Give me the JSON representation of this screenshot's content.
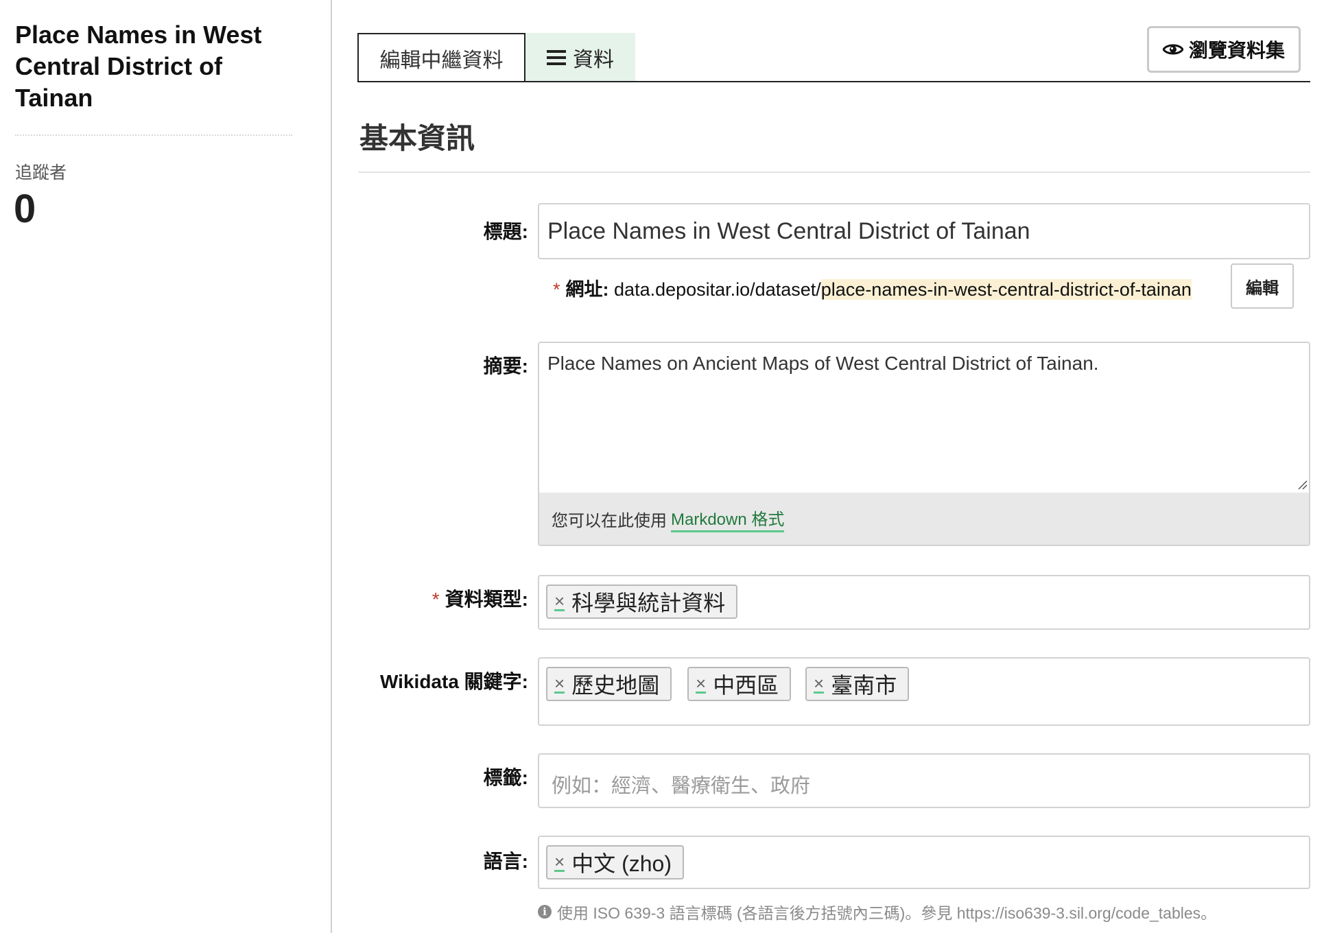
{
  "sidebar": {
    "dataset_title": "Place Names in West Central District of Tainan",
    "followers_label": "追蹤者",
    "followers_count": "0"
  },
  "tabs": [
    {
      "label": "編輯中繼資料"
    },
    {
      "label": "資料",
      "icon": "menu-icon"
    }
  ],
  "view_button": {
    "label": "瀏覽資料集",
    "icon": "eye-icon"
  },
  "section_title": "基本資訊",
  "form": {
    "title": {
      "label": "標題:",
      "value": "Place Names in West Central District of Tainan"
    },
    "url": {
      "required_mark": "*",
      "label": "網址:",
      "prefix": "data.depositar.io/dataset/",
      "slug": "place-names-in-west-central-district-of-tainan",
      "edit_label": "編輯"
    },
    "abstract": {
      "label": "摘要:",
      "value": "Place Names on Ancient Maps of West Central District of Tainan.",
      "markdown_prefix": "您可以在此使用",
      "markdown_link": "Markdown 格式"
    },
    "data_type": {
      "required_mark": "*",
      "label": "資料類型:",
      "tags": [
        "科學與統計資料"
      ]
    },
    "wikidata": {
      "label": "Wikidata 關鍵字:",
      "tags": [
        "歷史地圖",
        "中西區",
        "臺南市"
      ]
    },
    "tags": {
      "label": "標籤:",
      "placeholder": "例如：經濟、醫療衛生、政府"
    },
    "language": {
      "label": "語言:",
      "tags": [
        "中文 (zho)"
      ],
      "help": "使用 ISO 639-3 語言標碼 (各語言後方括號內三碼)。參見 https://iso639-3.sil.org/code_tables。"
    }
  },
  "tag_remove_glyph": "×",
  "colors": {
    "accent": "#5cc98b",
    "link": "#217a3d",
    "active_tab_bg": "#e6f3ea",
    "required": "#c0392b"
  }
}
